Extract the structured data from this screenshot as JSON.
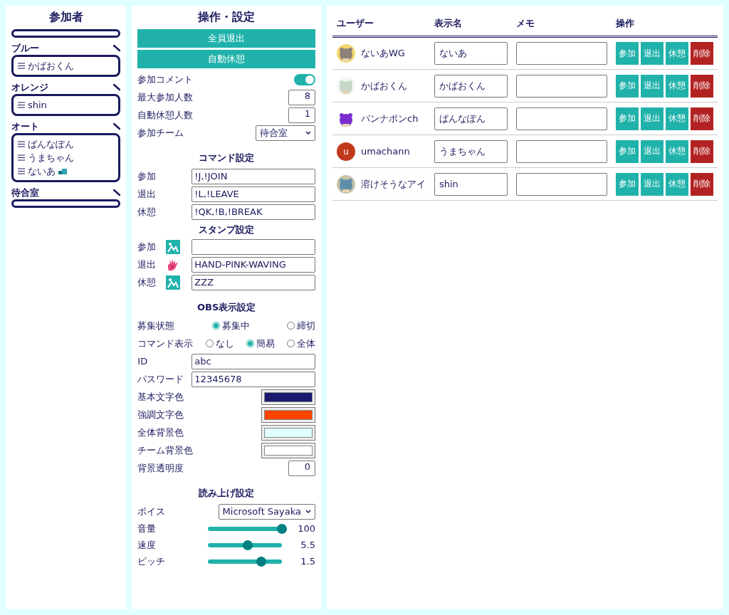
{
  "participants": {
    "title": "参加者",
    "teams": [
      {
        "name": "ブルー",
        "members": [
          {
            "name": "かばおくん",
            "badge": false
          }
        ]
      },
      {
        "name": "オレンジ",
        "members": [
          {
            "name": "shin",
            "badge": false
          }
        ]
      },
      {
        "name": "オート",
        "members": [
          {
            "name": "ばんなぽん",
            "badge": false
          },
          {
            "name": "うまちゃん",
            "badge": false
          },
          {
            "name": "ないあ",
            "badge": true
          }
        ]
      },
      {
        "name": "待合室"
      }
    ]
  },
  "settings": {
    "title": "操作・設定",
    "actions": [
      "全員退出",
      "自動休憩"
    ],
    "join_comment": {
      "label": "参加コメント",
      "on": true
    },
    "max_players": {
      "label": "最大参加人数",
      "value": "8"
    },
    "auto_break": {
      "label": "自動休憩人数",
      "value": "1"
    },
    "join_team": {
      "label": "参加チーム",
      "value": "待合室"
    },
    "command_title": "コマンド設定",
    "commands": [
      {
        "label": "参加",
        "value": "!J,!JOIN"
      },
      {
        "label": "退出",
        "value": "!L,!LEAVE"
      },
      {
        "label": "休憩",
        "value": "!QK,!B,!BREAK"
      }
    ],
    "stamp_title": "スタンプ設定",
    "stamps": [
      {
        "label": "参加",
        "kind": "placeholder"
      },
      {
        "label": "退出",
        "kind": "picture",
        "value": "HAND-PINK-WAVING"
      },
      {
        "label": "休憩",
        "kind": "placeholder",
        "value": "ZZZ"
      }
    ],
    "obs_title": "OBS表示設定",
    "radios": [
      {
        "label": "募集状態",
        "options": [
          {
            "label": "募集中",
            "selected": true
          },
          {
            "label": "締切",
            "selected": false
          }
        ]
      },
      {
        "label": "コマンド表示",
        "options": [
          {
            "label": "なし",
            "selected": false
          },
          {
            "label": "簡易",
            "selected": true
          },
          {
            "label": "全体",
            "selected": false
          }
        ]
      }
    ],
    "id": {
      "label": "ID",
      "value": "abc"
    },
    "password": {
      "label": "パスワード",
      "value": "12345678"
    },
    "colors": [
      {
        "label": "基本文字色",
        "color": "#191970"
      },
      {
        "label": "強調文字色",
        "color": "#ff4500"
      },
      {
        "label": "全体背景色",
        "color": "#e0ffff"
      },
      {
        "label": "チーム背景色",
        "color": "#ffffff"
      }
    ],
    "opacity": {
      "label": "背景透明度",
      "value": "0"
    },
    "speech_title": "読み上げ設定",
    "voice": {
      "label": "ボイス",
      "value": "Microsoft Sayaka"
    },
    "sliders": [
      {
        "label": "音量",
        "level": 1,
        "reading": "100"
      },
      {
        "label": "速度",
        "level": 0.54,
        "reading": "5.5"
      },
      {
        "label": "ピッチ",
        "level": 0.72,
        "reading": "1.5"
      }
    ]
  },
  "users": {
    "columns": [
      "ユーザー",
      "表示名",
      "メモ",
      "操作"
    ],
    "rows": [
      {
        "user": "ないあWG",
        "avatar": {
          "kind": "picture"
        },
        "display_name": "ないあ",
        "buttons": [
          {
            "label": "参加",
            "kind": "action"
          },
          {
            "label": "退出",
            "kind": "action"
          },
          {
            "label": "休憩",
            "kind": "action"
          },
          {
            "label": "削除",
            "kind": "delete"
          }
        ]
      },
      {
        "user": "かばおくん",
        "avatar": {
          "kind": "picture"
        },
        "display_name": "かばおくん",
        "buttons": [
          {
            "label": "参加",
            "kind": "action"
          },
          {
            "label": "退出",
            "kind": "action"
          },
          {
            "label": "休憩",
            "kind": "action"
          },
          {
            "label": "削除",
            "kind": "delete"
          }
        ]
      },
      {
        "user": "パンナポンch",
        "avatar": {
          "kind": "picture"
        },
        "display_name": "ぱんなぽん",
        "buttons": [
          {
            "label": "参加",
            "kind": "action"
          },
          {
            "label": "退出",
            "kind": "action"
          },
          {
            "label": "休憩",
            "kind": "action"
          },
          {
            "label": "削除",
            "kind": "delete"
          }
        ]
      },
      {
        "user": "umachann",
        "avatar": {
          "kind": "letter",
          "letter": "u"
        },
        "display_name": "うまちゃん",
        "buttons": [
          {
            "label": "参加",
            "kind": "action"
          },
          {
            "label": "退出",
            "kind": "action"
          },
          {
            "label": "休憩",
            "kind": "action"
          },
          {
            "label": "削除",
            "kind": "delete"
          }
        ]
      },
      {
        "user": "溶けそうなアイ",
        "avatar": {
          "kind": "picture"
        },
        "display_name": "shin",
        "buttons": [
          {
            "label": "参加",
            "kind": "action"
          },
          {
            "label": "退出",
            "kind": "action"
          },
          {
            "label": "休憩",
            "kind": "action"
          },
          {
            "label": "削除",
            "kind": "delete"
          }
        ]
      }
    ]
  }
}
